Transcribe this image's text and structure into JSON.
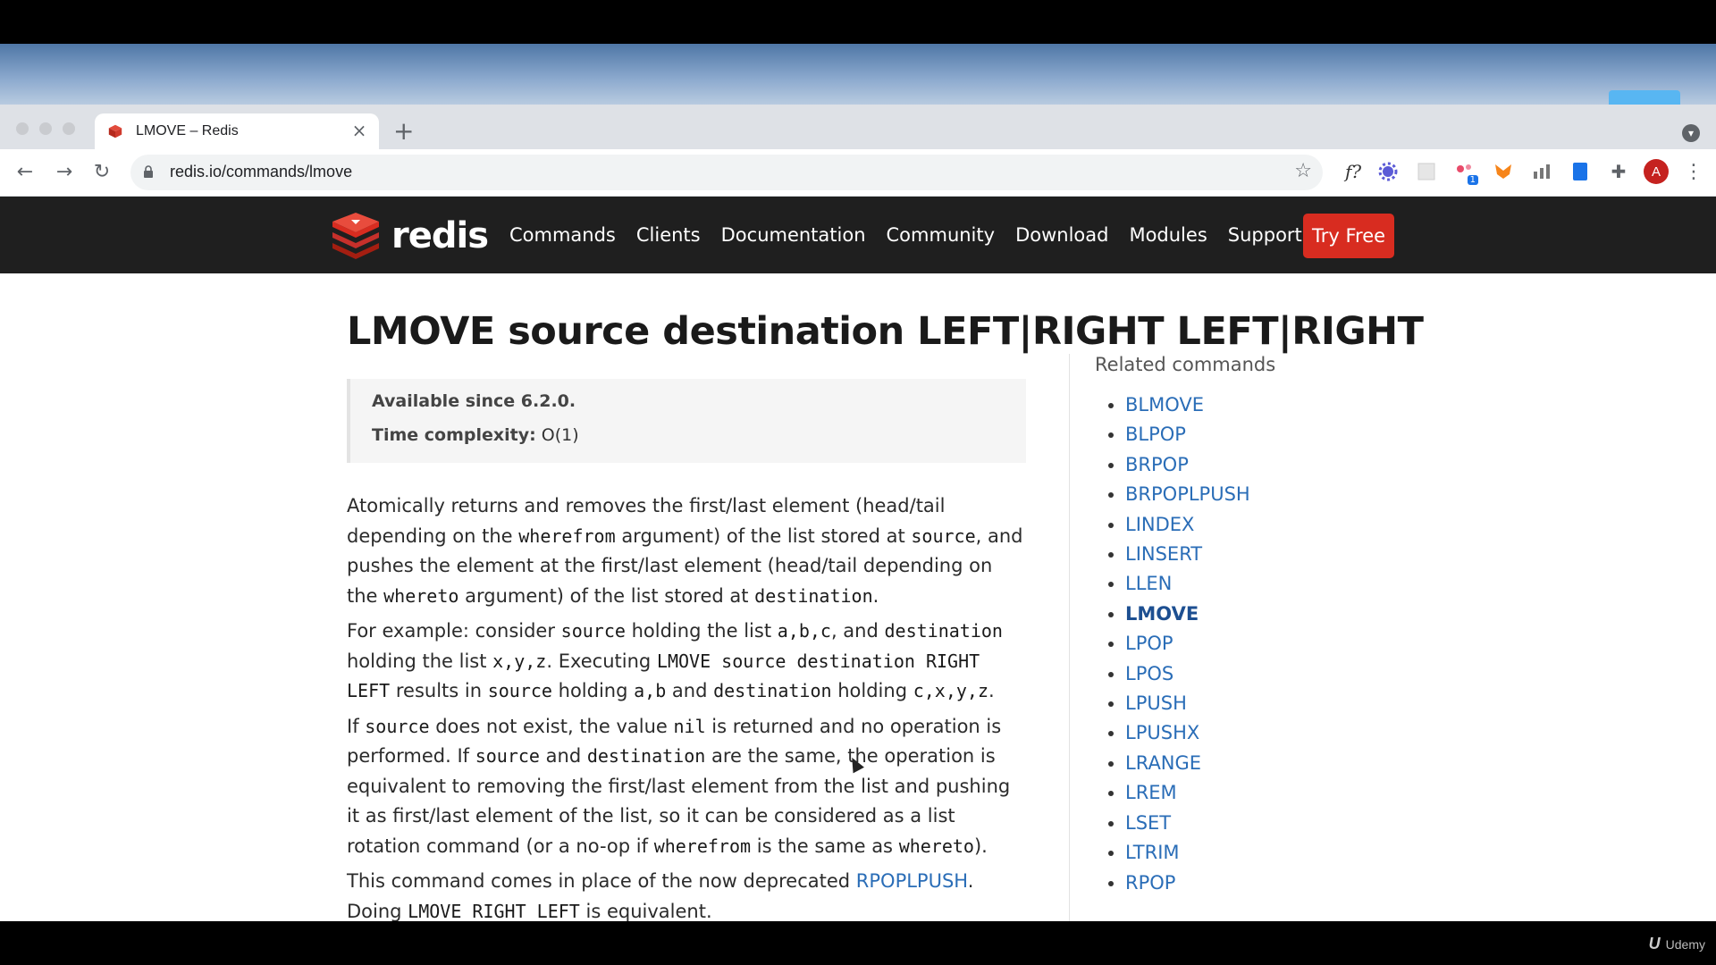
{
  "browser": {
    "tab_title": "LMOVE – Redis",
    "tab_close_glyph": "×",
    "new_tab_glyph": "+",
    "url": "redis.io/commands/lmove",
    "back_glyph": "←",
    "forward_glyph": "→",
    "reload_glyph": "↻",
    "bookmark_glyph": "☆",
    "extensions": {
      "formula": "f?",
      "badge_count": "1",
      "avatar_letter": "A"
    },
    "menu_glyph": "⋮"
  },
  "site": {
    "logo_text": "redis",
    "nav": [
      "Commands",
      "Clients",
      "Documentation",
      "Community",
      "Download",
      "Modules",
      "Support"
    ],
    "cta": "Try Free",
    "brand_color": "#d82c20"
  },
  "page": {
    "title": "LMOVE source destination LEFT|RIGHT LEFT|RIGHT",
    "available_label": "Available since 6.2.0.",
    "complexity_label": "Time complexity:",
    "complexity_value": "O(1)",
    "p1": {
      "t1": "Atomically returns and removes the first/last element (head/tail depending on the ",
      "c1": "wherefrom",
      "t2": " argument) of the list stored at ",
      "c2": "source",
      "t3": ", and pushes the element at the first/last element (head/tail depending on the ",
      "c3": "whereto",
      "t4": " argument) of the list stored at ",
      "c4": "destination",
      "t5": "."
    },
    "p2": {
      "t1": "For example: consider ",
      "c1": "source",
      "t2": " holding the list ",
      "c2": "a,b,c",
      "t3": ", and ",
      "c3": "destination",
      "t4": " holding the list ",
      "c4": "x,y,z",
      "t5": ". Executing ",
      "c5": "LMOVE source destination RIGHT LEFT",
      "t6": " results in ",
      "c6": "source",
      "t7": " holding ",
      "c7": "a,b",
      "t8": " and ",
      "c8": "destination",
      "t9": " holding ",
      "c9": "c,x,y,z",
      "t10": "."
    },
    "p3": {
      "t1": "If ",
      "c1": "source",
      "t2": " does not exist, the value ",
      "c2": "nil",
      "t3": " is returned and no operation is performed. If ",
      "c3": "source",
      "t4": " and ",
      "c4": "destination",
      "t5": " are the same, the operation is equivalent to removing the first/last element from the list and pushing it as first/last element of the list, so it can be considered as a list rotation command (or a no-op if ",
      "c5": "wherefrom",
      "t6": " is the same as ",
      "c6": "whereto",
      "t7": ")."
    },
    "p4": {
      "t1": "This command comes in place of the now deprecated ",
      "link": "RPOPLPUSH",
      "t2": ". Doing ",
      "c1": "LMOVE RIGHT LEFT",
      "t3": " is equivalent."
    },
    "related_title": "Related commands",
    "related": [
      "BLMOVE",
      "BLPOP",
      "BRPOP",
      "BRPOPLPUSH",
      "LINDEX",
      "LINSERT",
      "LLEN",
      "LMOVE",
      "LPOP",
      "LPOS",
      "LPUSH",
      "LPUSHX",
      "LRANGE",
      "LREM",
      "LSET",
      "LTRIM",
      "RPOP"
    ],
    "related_current": "LMOVE"
  },
  "watermark": "Udemy"
}
